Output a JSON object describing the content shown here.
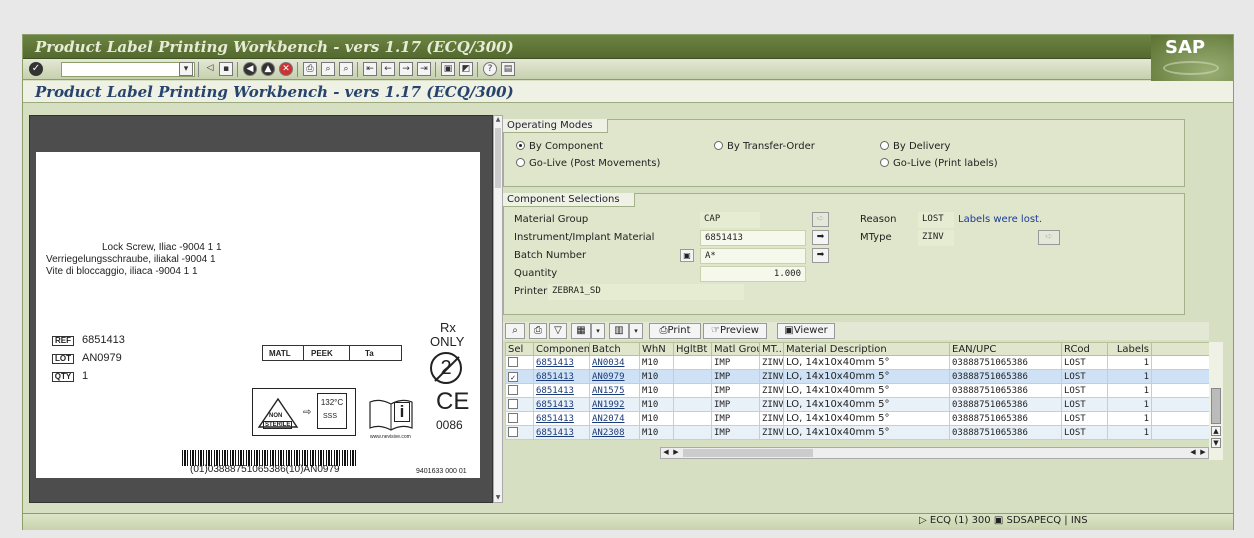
{
  "window": {
    "title": "Product Label Printing Workbench  - vers 1.17 (ECQ/300)",
    "logo": "SAP"
  },
  "screen_title": "Product Label Printing Workbench  - vers 1.17 (ECQ/300)",
  "label_preview": {
    "line1": "Lock Screw, Iliac -9004  1     1",
    "line2": "Verriegelungsschraube, iliakal -9004  1",
    "line3": "Vite di bloccaggio, iliaca -9004  1    1",
    "ref_tag": "REF",
    "ref_value": "6851413",
    "lot_tag": "LOT",
    "lot_value": "AN0979",
    "qty_tag": "QTY",
    "qty_value": "1",
    "matl_label": "MATL",
    "matl_value1": "PEEK",
    "matl_value2": "Ta",
    "rx": "Rx",
    "only": "ONLY",
    "reuse_symbol": "2",
    "non_sterile_1": "NON",
    "non_sterile_2": "STERILE",
    "temp": "132°C",
    "temp_sub": "SSS",
    "info": "i",
    "website": "www.nevisive.com",
    "ce": "CE",
    "ce_number": "0086",
    "barcode_text": "(01)03888751065386(10)AN0979",
    "part_code": "9401633 000 01"
  },
  "operating_modes": {
    "title": "Operating Modes",
    "options": [
      "By Component",
      "By Transfer-Order",
      "By Delivery",
      "Go-Live (Post Movements)",
      "Go-Live (Print labels)"
    ],
    "selected": "By Component"
  },
  "component_selections": {
    "title": "Component Selections",
    "material_group_label": "Material Group",
    "material_group_value": "CAP",
    "instrument_label": "Instrument/Implant Material",
    "instrument_value": "6851413",
    "batch_label": "Batch Number",
    "batch_value": "A*",
    "quantity_label": "Quantity",
    "quantity_value": "1.000",
    "printer_label": "Printer",
    "printer_value": "ZEBRA1_SD",
    "reason_label": "Reason",
    "reason_value": "LOST",
    "reason_text": "Labels were lost.",
    "mtype_label": "MType",
    "mtype_value": "ZINV"
  },
  "grid_toolbar": {
    "print": "Print",
    "preview": "Preview",
    "viewer": "Viewer"
  },
  "grid": {
    "columns": [
      "Sel",
      "Component",
      "Batch",
      "WhN",
      "HgltBt",
      "Matl Group",
      "MT...",
      "Material Description",
      "EAN/UPC",
      "RCod",
      "Labels"
    ],
    "rows": [
      {
        "sel": "",
        "component": "6851413",
        "batch": "AN0034",
        "whn": "M10",
        "hgltbt": "",
        "matl_group": "IMP",
        "mt": "ZINV",
        "desc": "LO, 14x10x40mm 5°",
        "ean": "03888751065386",
        "rcod": "LOST",
        "labels": "1"
      },
      {
        "sel": "✓",
        "component": "6851413",
        "batch": "AN0979",
        "whn": "M10",
        "hgltbt": "",
        "matl_group": "IMP",
        "mt": "ZINV",
        "desc": "LO, 14x10x40mm 5°",
        "ean": "03888751065386",
        "rcod": "LOST",
        "labels": "1"
      },
      {
        "sel": "",
        "component": "6851413",
        "batch": "AN1575",
        "whn": "M10",
        "hgltbt": "",
        "matl_group": "IMP",
        "mt": "ZINV",
        "desc": "LO, 14x10x40mm 5°",
        "ean": "03888751065386",
        "rcod": "LOST",
        "labels": "1"
      },
      {
        "sel": "",
        "component": "6851413",
        "batch": "AN1992",
        "whn": "M10",
        "hgltbt": "",
        "matl_group": "IMP",
        "mt": "ZINV",
        "desc": "LO, 14x10x40mm 5°",
        "ean": "03888751065386",
        "rcod": "LOST",
        "labels": "1"
      },
      {
        "sel": "",
        "component": "6851413",
        "batch": "AN2074",
        "whn": "M10",
        "hgltbt": "",
        "matl_group": "IMP",
        "mt": "ZINV",
        "desc": "LO, 14x10x40mm 5°",
        "ean": "03888751065386",
        "rcod": "LOST",
        "labels": "1"
      },
      {
        "sel": "",
        "component": "6851413",
        "batch": "AN2308",
        "whn": "M10",
        "hgltbt": "",
        "matl_group": "IMP",
        "mt": "ZINV",
        "desc": "LO, 14x10x40mm 5°",
        "ean": "03888751065386",
        "rcod": "LOST",
        "labels": "1"
      }
    ]
  },
  "status_bar": {
    "system": "ECQ (1) 300",
    "server": "SDSAPECQ",
    "mode": "INS"
  },
  "colors": {
    "title_bar": "#5f7638",
    "screen_title": "#27446e",
    "link": "#1a3a7a",
    "panel": "#dfe6cc"
  }
}
